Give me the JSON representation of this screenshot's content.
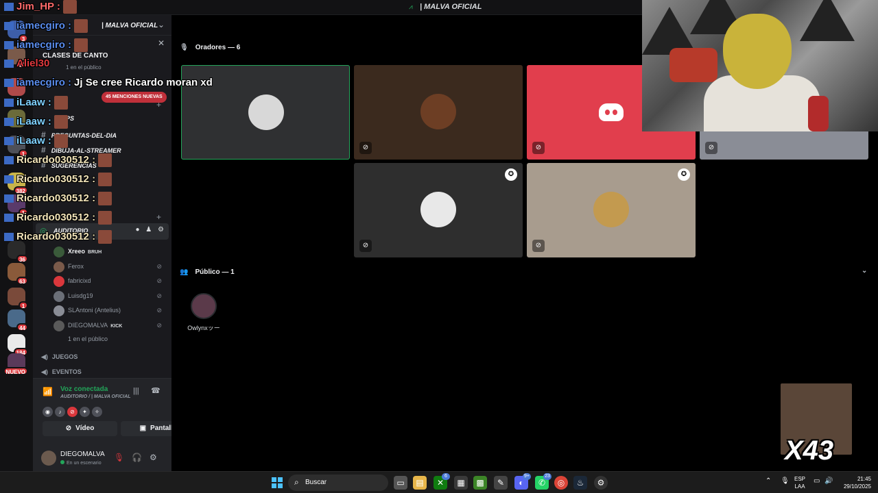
{
  "window": {
    "title": "| MALVA OFICIAL"
  },
  "server": {
    "name": "| MALVA OFICIAL"
  },
  "event_card": {
    "title": "CLASES DE CANTO",
    "subtitle": "1 en el público"
  },
  "mentions_pill": "45 MENCIONES NUEVAS",
  "rail_badges": [
    "3",
    "45",
    "1",
    "382",
    "1",
    "36",
    "63",
    "1",
    "44",
    "184",
    "NUEVO"
  ],
  "channels": [
    {
      "name": "TIPS"
    },
    {
      "name": "PREGUNTAS-DEL-DIA"
    },
    {
      "name": "DIBUJA-AL-STREAMER"
    },
    {
      "name": "SUGERENCIAS"
    }
  ],
  "voice_channel": {
    "name": "AUDITORIO"
  },
  "members": [
    {
      "name": "Xreeo",
      "tag": "BRUH",
      "bold": true,
      "muted": false
    },
    {
      "name": "Ferox",
      "tag": "",
      "bold": false,
      "muted": true
    },
    {
      "name": "fabricixd",
      "tag": "",
      "bold": false,
      "muted": true
    },
    {
      "name": "Luisdg19",
      "tag": "",
      "bold": false,
      "muted": true
    },
    {
      "name": "SLAntoni (Antelius)",
      "tag": "",
      "bold": false,
      "muted": true
    },
    {
      "name": "DIEGOMALVA",
      "tag": "KICK",
      "bold": false,
      "muted": true
    }
  ],
  "audience_line": "1 en el público",
  "categories": {
    "games": "JUEGOS",
    "events": "EVENTOS"
  },
  "connection": {
    "status": "Voz conectada",
    "location": "AUDITORIO / | MALVA OFICIAL",
    "video_label": "Vídeo",
    "screen_label": "Pantalla"
  },
  "user": {
    "name": "DIEGOMALVA",
    "status": "En un escenario"
  },
  "stage": {
    "speakers_title": "Oradores — 6",
    "public_title": "Público — 1",
    "audience": [
      {
        "name": "Owlynxッー"
      }
    ]
  },
  "tiles": [
    {
      "bg": "#2f3032",
      "highlight": true
    },
    {
      "bg": "#3b2a1e",
      "highlight": false
    },
    {
      "bg": "#e13e4d",
      "highlight": false
    },
    {
      "bg": "#8a8d96",
      "highlight": false
    },
    {
      "bg": "#2e2e2e",
      "highlight": false
    },
    {
      "bg": "#a89c8e",
      "highlight": false
    }
  ],
  "chat": [
    {
      "user": "Jim_HP",
      "sep": " :",
      "msg": "",
      "color": "#ff6b6b"
    },
    {
      "user": "iamecgiro",
      "sep": " :",
      "msg": "",
      "color": "#5a8dee"
    },
    {
      "user": "iamecgiro",
      "sep": " :",
      "msg": "",
      "color": "#5a8dee"
    },
    {
      "user": "Aliel30",
      "sep": "",
      "msg": "",
      "color": "#e0393e"
    },
    {
      "user": "iamecgiro",
      "sep": " :",
      "msg": "Jj Se cree Ricardo moran xd",
      "color": "#5a8dee"
    },
    {
      "user": "iLaaw",
      "sep": " :",
      "msg": "",
      "color": "#7fd1ff"
    },
    {
      "user": "iLaaw",
      "sep": " :",
      "msg": "",
      "color": "#7fd1ff"
    },
    {
      "user": "iLaaw",
      "sep": " :",
      "msg": "",
      "color": "#7fd1ff"
    },
    {
      "user": "Ricardo030512",
      "sep": " :",
      "msg": "",
      "color": "#f1e3b8"
    },
    {
      "user": "Ricardo030512",
      "sep": " :",
      "msg": "",
      "color": "#f1e3b8"
    },
    {
      "user": "Ricardo030512",
      "sep": " :",
      "msg": "",
      "color": "#f1e3b8"
    },
    {
      "user": "Ricardo030512",
      "sep": " :",
      "msg": "",
      "color": "#f1e3b8"
    },
    {
      "user": "Ricardo030512",
      "sep": " :",
      "msg": "",
      "color": "#f1e3b8"
    }
  ],
  "meme": {
    "count": "X43"
  },
  "taskbar": {
    "search_placeholder": "Buscar",
    "lang_top": "ESP",
    "lang_bottom": "LAA",
    "time": "21:45",
    "date": "29/10/2025",
    "badge_xbox": "6",
    "badge_discord": "9+",
    "badge_whatsapp": "23"
  },
  "colors": {
    "accent_green": "#23a55a",
    "danger": "#da373c",
    "blurple": "#5865f2"
  }
}
